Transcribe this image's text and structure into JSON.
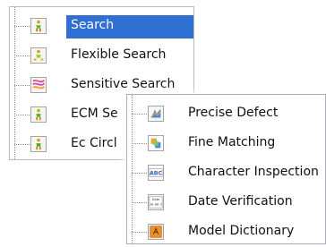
{
  "back_tree": {
    "items": [
      {
        "label": "Search",
        "icon": "person-search-icon",
        "selected": true
      },
      {
        "label": "Flexible Search",
        "icon": "person-arrows-icon",
        "selected": false
      },
      {
        "label": "Sensitive Search",
        "icon": "sensitive-search-icon",
        "selected": false
      },
      {
        "label": "ECM Se",
        "icon": "ecm-search-icon",
        "selected": false
      },
      {
        "label": "Ec Circl",
        "icon": "circle-search-icon",
        "selected": false
      }
    ],
    "selection_color": "#2f6fd2"
  },
  "front_tree": {
    "items": [
      {
        "label": "Precise Defect",
        "icon": "precise-defect-icon"
      },
      {
        "label": "Fine Matching",
        "icon": "fine-matching-icon"
      },
      {
        "label": "Character Inspection",
        "icon": "character-inspection-icon",
        "icon_text": "ABC"
      },
      {
        "label": "Date Verification",
        "icon": "date-verification-icon",
        "icon_text_1": "Date",
        "icon_text_2": "10-08-1"
      },
      {
        "label": "Model Dictionary",
        "icon": "model-dictionary-icon"
      }
    ]
  }
}
